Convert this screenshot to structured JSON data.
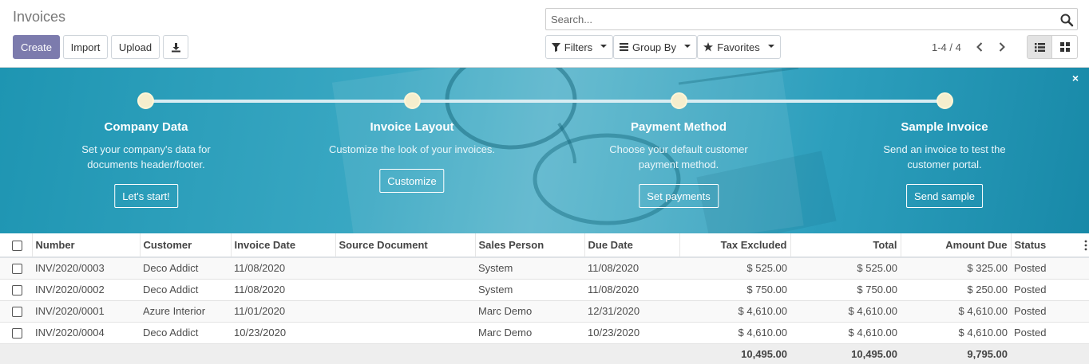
{
  "control_panel": {
    "title": "Invoices",
    "create_label": "Create",
    "import_label": "Import",
    "upload_label": "Upload",
    "search_placeholder": "Search...",
    "filters_label": "Filters",
    "group_by_label": "Group By",
    "favorites_label": "Favorites",
    "pager_value": "1-4 / 4"
  },
  "banner": {
    "steps": [
      {
        "title": "Company Data",
        "desc_lines": [
          "Set your company's data for",
          "documents header/footer."
        ],
        "button": "Let's start!"
      },
      {
        "title": "Invoice Layout",
        "desc_lines": [
          "Customize the look of your invoices.",
          ""
        ],
        "button": "Customize"
      },
      {
        "title": "Payment Method",
        "desc_lines": [
          "Choose your default customer",
          "payment method."
        ],
        "button": "Set payments"
      },
      {
        "title": "Sample Invoice",
        "desc_lines": [
          "Send an invoice to test the",
          "customer portal."
        ],
        "button": "Send sample"
      }
    ],
    "close_symbol": "×"
  },
  "table": {
    "headers": [
      "Number",
      "Customer",
      "Invoice Date",
      "Source Document",
      "Sales Person",
      "Due Date",
      "Tax Excluded",
      "Total",
      "Amount Due",
      "Status"
    ],
    "rows": [
      {
        "number": "INV/2020/0003",
        "customer": "Deco Addict",
        "invoice_date": "11/08/2020",
        "source": "",
        "sales_person": "System",
        "due_date": "11/08/2020",
        "tax_excluded": "$ 525.00",
        "total": "$ 525.00",
        "amount_due": "$ 325.00",
        "status": "Posted"
      },
      {
        "number": "INV/2020/0002",
        "customer": "Deco Addict",
        "invoice_date": "11/08/2020",
        "source": "",
        "sales_person": "System",
        "due_date": "11/08/2020",
        "tax_excluded": "$ 750.00",
        "total": "$ 750.00",
        "amount_due": "$ 250.00",
        "status": "Posted"
      },
      {
        "number": "INV/2020/0001",
        "customer": "Azure Interior",
        "invoice_date": "11/01/2020",
        "source": "",
        "sales_person": "Marc Demo",
        "due_date": "12/31/2020",
        "tax_excluded": "$ 4,610.00",
        "total": "$ 4,610.00",
        "amount_due": "$ 4,610.00",
        "status": "Posted"
      },
      {
        "number": "INV/2020/0004",
        "customer": "Deco Addict",
        "invoice_date": "10/23/2020",
        "source": "",
        "sales_person": "Marc Demo",
        "due_date": "10/23/2020",
        "tax_excluded": "$ 4,610.00",
        "total": "$ 4,610.00",
        "amount_due": "$ 4,610.00",
        "status": "Posted"
      }
    ],
    "totals": {
      "tax_excluded": "10,495.00",
      "total": "10,495.00",
      "amount_due": "9,795.00"
    }
  },
  "colors": {
    "primary": "#7c7bad",
    "banner": "#2d9fbd"
  },
  "icons": {
    "search": "magnifier-icon",
    "download": "download-icon",
    "filter": "funnel-icon",
    "group": "bars-icon",
    "favorites": "star-icon",
    "list_view": "list-icon",
    "kanban_view": "grid-icon"
  }
}
